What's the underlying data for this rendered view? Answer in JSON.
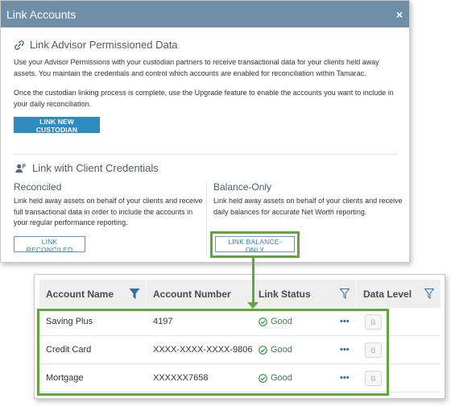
{
  "modal": {
    "title": "Link Accounts",
    "close_glyph": "×",
    "advisor_section": {
      "icon": "link-icon",
      "heading": "Link Advisor Permissioned Data",
      "paragraph1": "Use your Advisor Permissions with your custodian partners to receive transactional data for your clients held away assets. You maintain the credentials and control which accounts are enabled for reconciliation within Tamarac.",
      "paragraph2": "Once the custodian linking process is complete, use the Upgrade feature to enable the accounts you want to include in your daily reconciliation.",
      "button_label": "LINK NEW CUSTODIAN"
    },
    "client_section": {
      "icon": "user-key-icon",
      "heading": "Link with Client Credentials",
      "reconciled": {
        "title": "Reconciled",
        "description": "Link held away assets on behalf of your clients and receive full transactional data in order to include the accounts in your regular performance reporting.",
        "button_label": "LINK RECONCILED"
      },
      "balance_only": {
        "title": "Balance-Only",
        "description": "Link held away assets on behalf of your clients and receive daily balances for accurate Net Worth reporting.",
        "button_label": "LINK BALANCE-ONLY"
      }
    }
  },
  "table": {
    "columns": [
      {
        "label": "Account Name",
        "filter_active": true
      },
      {
        "label": "Account Number",
        "filter_active": false
      },
      {
        "label": "Link Status",
        "filter_active": false
      },
      {
        "label": "Data Level",
        "filter_active": false
      }
    ],
    "rows": [
      {
        "name": "Saving Plus",
        "number": "4197",
        "status": "Good",
        "menu": "•••",
        "level": "B"
      },
      {
        "name": "Credit Card",
        "number": "XXXX-XXXX-XXXX-9806",
        "status": "Good",
        "menu": "•••",
        "level": "B"
      },
      {
        "name": "Mortgage",
        "number": "XXXXXX7658",
        "status": "Good",
        "menu": "•••",
        "level": "B"
      }
    ]
  },
  "colors": {
    "header_bg": "#6f8fa8",
    "primary_button": "#2e8bc0",
    "highlight": "#5ea83b",
    "status_good": "#2f8a43"
  }
}
